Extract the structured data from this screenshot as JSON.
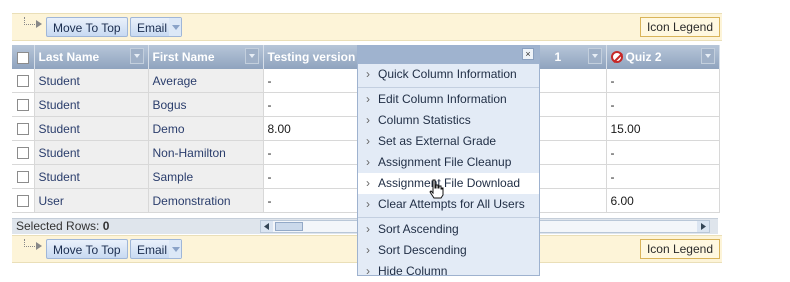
{
  "toolbar": {
    "move_to_top_label": "Move To Top",
    "email_label": "Email",
    "icon_legend_label": "Icon Legend"
  },
  "grid": {
    "columns": [
      "Last Name",
      "First Name",
      "Testing version",
      "",
      "1",
      "Quiz 2"
    ],
    "rows": [
      {
        "last": "Student",
        "first": "Average",
        "testing": "-",
        "c4": "",
        "c5": "",
        "quiz2": "-"
      },
      {
        "last": "Student",
        "first": "Bogus",
        "testing": "-",
        "c4": "",
        "c5": "",
        "quiz2": "-"
      },
      {
        "last": "Student",
        "first": "Demo",
        "testing": "8.00",
        "c4": "",
        "c5": "",
        "quiz2": "15.00"
      },
      {
        "last": "Student",
        "first": "Non-Hamilton",
        "testing": "-",
        "c4": "",
        "c5": "",
        "quiz2": "-"
      },
      {
        "last": "Student",
        "first": "Sample",
        "testing": "-",
        "c4": "",
        "c5": "",
        "quiz2": "-"
      },
      {
        "last": "User",
        "first": "Demonstration",
        "testing": "-",
        "c4": "",
        "c5": "",
        "quiz2": "6.00"
      }
    ],
    "selected_rows_label": "Selected Rows:",
    "selected_rows_count": "0"
  },
  "context_menu": {
    "close_glyph": "×",
    "items": [
      "Quick Column Information",
      "Edit Column Information",
      "Column Statistics",
      "Set as External Grade",
      "Assignment File Cleanup",
      "Assignment File Download",
      "Clear Attempts for All Users",
      "Sort Ascending",
      "Sort Descending",
      "Hide Column"
    ],
    "hovered_item": "Assignment File Download"
  },
  "icons": {
    "quiz2_status": "no-entry-icon",
    "cursor": "hand-pointer-icon"
  },
  "colors": {
    "action_bar": "#fdf4d8",
    "header_bg": "#8fa3be",
    "name_col_bg": "#efefef",
    "menu_bg": "#e3ebf6"
  }
}
